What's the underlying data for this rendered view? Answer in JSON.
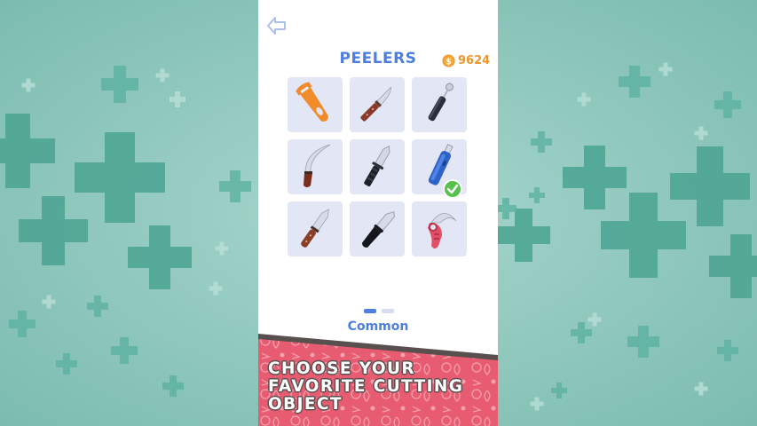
{
  "screen": {
    "title": "PEELERS",
    "coins": "9624",
    "rarity": "Common"
  },
  "banner": {
    "lines": [
      "CHOOSE YOUR",
      "FAVORITE CUTTING",
      "OBJECT"
    ]
  },
  "items": [
    {
      "icon": "peeler-icon",
      "selected": false
    },
    {
      "icon": "boning-knife-icon",
      "selected": false
    },
    {
      "icon": "melon-baller-icon",
      "selected": false
    },
    {
      "icon": "curved-blade-icon",
      "selected": false
    },
    {
      "icon": "tactical-knife-icon",
      "selected": false
    },
    {
      "icon": "utility-knife-icon",
      "selected": true
    },
    {
      "icon": "paring-knife-icon",
      "selected": false
    },
    {
      "icon": "black-kitchen-knife-icon",
      "selected": false
    },
    {
      "icon": "karambit-icon",
      "selected": false
    }
  ],
  "pager": {
    "pages": 2,
    "active": 0
  },
  "colors": {
    "background": "#8cc4ba",
    "accent_blue": "#4c7fe0",
    "coin_orange": "#f0952a",
    "banner_pink": "#e85c72",
    "check_green": "#55c24b",
    "cell_bg": "#e3e6f4"
  }
}
